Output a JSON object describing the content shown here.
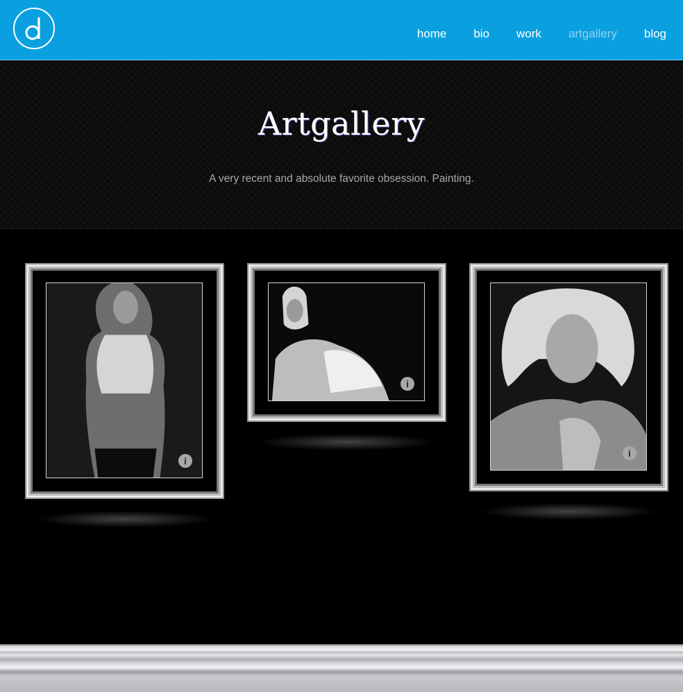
{
  "header": {
    "logo_letter": "d",
    "nav": [
      {
        "label": "home",
        "active": false
      },
      {
        "label": "bio",
        "active": false
      },
      {
        "label": "work",
        "active": false
      },
      {
        "label": "artgallery",
        "active": true
      },
      {
        "label": "blog",
        "active": false
      }
    ],
    "colors": {
      "bar": "#0aa0df",
      "active_link": "#8fd2ef"
    }
  },
  "hero": {
    "title": "Artgallery",
    "subtitle": "A very recent and absolute favorite obsession. Painting."
  },
  "gallery": {
    "paintings": [
      {
        "subject": "standing woman in white shirt",
        "info_icon": "info-icon",
        "info_glyph": "i"
      },
      {
        "subject": "seated woman with headscarf",
        "info_icon": "info-icon",
        "info_glyph": "i"
      },
      {
        "subject": "blonde woman portrait",
        "info_icon": "info-icon",
        "info_glyph": "i"
      }
    ]
  }
}
